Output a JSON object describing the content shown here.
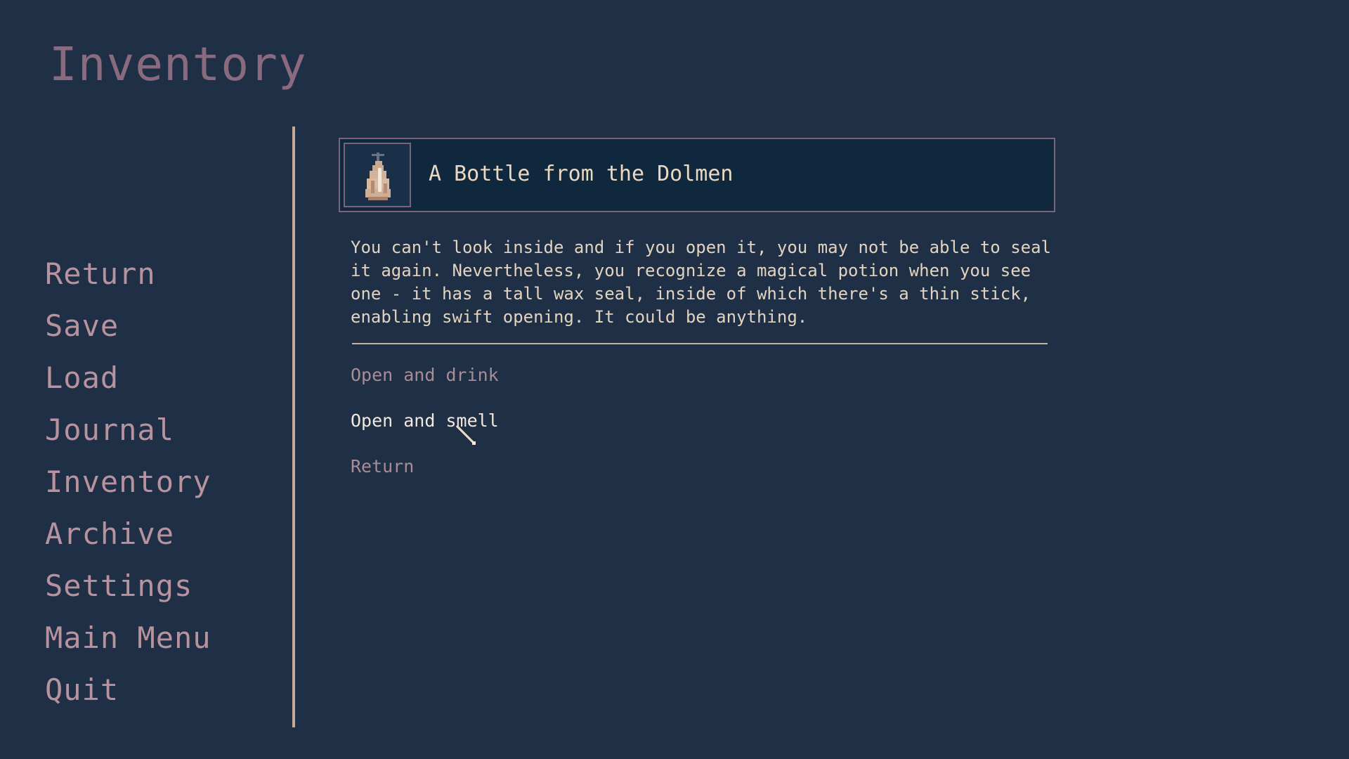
{
  "screen": {
    "title": "Inventory"
  },
  "sidebar": {
    "items": [
      {
        "label": "Return"
      },
      {
        "label": "Save"
      },
      {
        "label": "Load"
      },
      {
        "label": "Journal"
      },
      {
        "label": "Inventory"
      },
      {
        "label": "Archive"
      },
      {
        "label": "Settings"
      },
      {
        "label": "Main Menu"
      },
      {
        "label": "Quit"
      }
    ]
  },
  "item": {
    "icon": "potion-bottle-icon",
    "name": "A Bottle from the Dolmen",
    "description": "You can't look inside and if you open it, you may not be able to seal it again. Nevertheless, you recognize a magical potion when you see one - it has a tall wax seal, inside of which there's a thin stick, enabling swift opening. It could be anything."
  },
  "options": [
    {
      "label": "Open and drink",
      "state": "normal"
    },
    {
      "label": "Open and smell",
      "state": "hovered"
    },
    {
      "label": "Return",
      "state": "normal"
    }
  ],
  "colors": {
    "background": "#1f2f45",
    "title": "#8a6a7e",
    "menu_text": "#b8929e",
    "panel_bg": "#10283e",
    "panel_border": "#7a647a",
    "text": "#e2d3c0",
    "option_text": "#a88c98",
    "option_hover": "#f2e8de",
    "divider": "#c7a896"
  }
}
